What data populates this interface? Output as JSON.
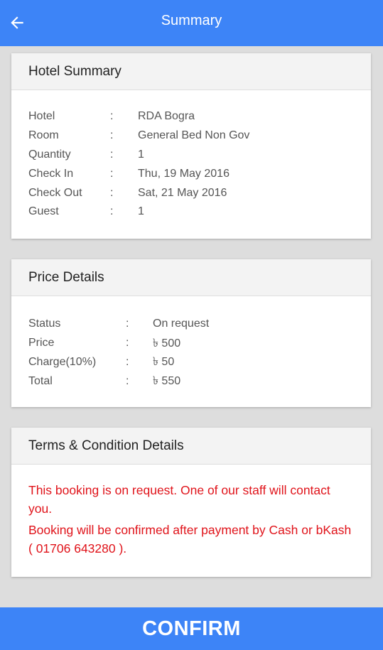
{
  "header": {
    "title": "Summary",
    "back_icon": "arrow-left-icon"
  },
  "hotel_summary": {
    "title": "Hotel Summary",
    "rows": [
      {
        "label": "Hotel",
        "sep": ":",
        "value": "RDA Bogra"
      },
      {
        "label": "Room",
        "sep": ":",
        "value": "General Bed Non Gov"
      },
      {
        "label": "Quantity",
        "sep": ":",
        "value": "1"
      },
      {
        "label": "Check In",
        "sep": ":",
        "value": "Thu, 19 May 2016"
      },
      {
        "label": "Check Out",
        "sep": ":",
        "value": "Sat, 21 May 2016"
      },
      {
        "label": "Guest",
        "sep": ":",
        "value": "1"
      }
    ]
  },
  "price_details": {
    "title": "Price Details",
    "rows": [
      {
        "label": "Status",
        "sep": ":",
        "value": "On request"
      },
      {
        "label": "Price",
        "sep": ":",
        "value": "৳ 500"
      },
      {
        "label": "Charge(10%)",
        "sep": ":",
        "value": "৳ 50"
      },
      {
        "label": "Total",
        "sep": ":",
        "value": "৳ 550"
      }
    ]
  },
  "terms": {
    "title": "Terms & Condition Details",
    "lines": [
      "This booking is on request. One of our staff will contact you.",
      "Booking will be confirmed after payment by Cash or bKash ( 01706 643280 )."
    ]
  },
  "confirm_label": "CONFIRM",
  "colors": {
    "primary": "#3d84f7",
    "terms_text": "#e0131a",
    "background": "#dddddd"
  }
}
